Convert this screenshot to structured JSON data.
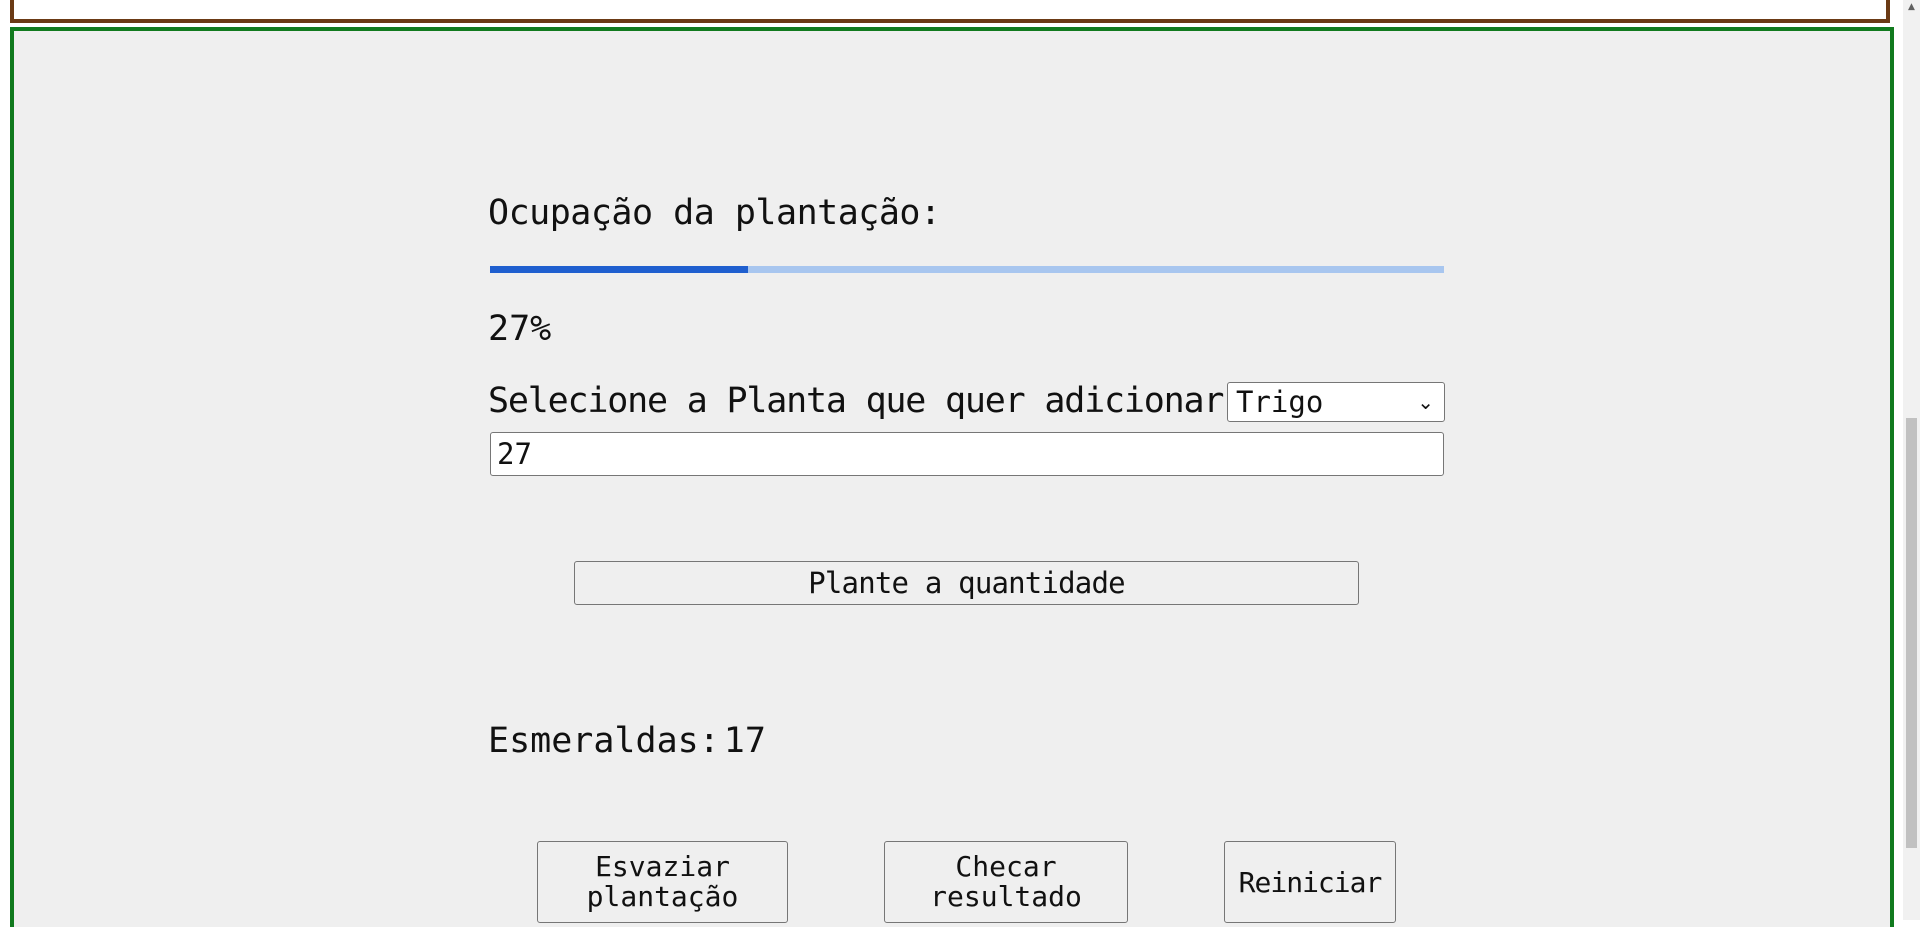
{
  "occupancy": {
    "label": "Ocupação da plantação:",
    "progress_fraction": 0.27,
    "percent_text": "27%"
  },
  "plant_selection": {
    "label": "Selecione a Planta que quer adicionar:",
    "selected_option": "Trigo",
    "chevron_icon": "chevron-down-icon"
  },
  "quantity_input": {
    "value": "27"
  },
  "buttons": {
    "plant_label": "Plante a quantidade",
    "empty_line1": "Esvaziar",
    "empty_line2": "plantação",
    "check_line1": "Checar",
    "check_line2": "resultado",
    "restart_label": "Reiniciar"
  },
  "emeralds": {
    "label": "Esmeraldas:",
    "value": "17"
  },
  "colors": {
    "top_panel_border": "#6b3a15",
    "main_panel_border": "#117a1e",
    "progress_fill": "#1f5fcf",
    "progress_track": "#a8c6ef",
    "panel_background": "#efefef"
  }
}
